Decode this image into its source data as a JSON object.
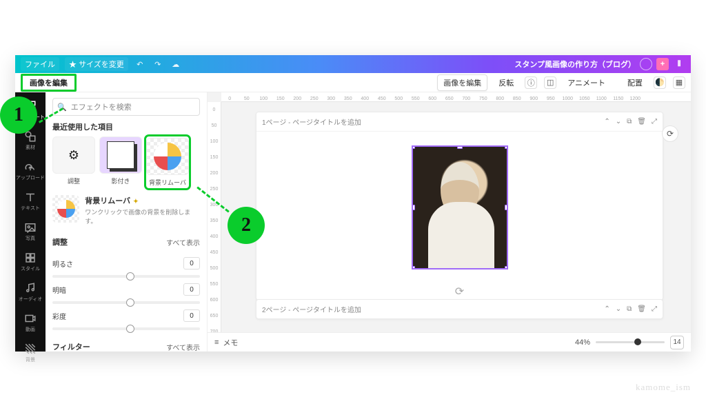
{
  "topbar": {
    "file": "ファイル",
    "resize": "サイズを変更",
    "title": "スタンプ風画像の作り方（ブログ）"
  },
  "ctxbar": {
    "edit_image": "画像を編集",
    "edit_image_btn": "画像を編集",
    "flip": "反転",
    "animate": "アニメート",
    "arrange": "配置"
  },
  "vnav": {
    "template": "テンプレート",
    "elements": "素材",
    "upload": "アップロード",
    "text": "テキスト",
    "photo": "写真",
    "style": "スタイル",
    "audio": "オーディオ",
    "video": "動画",
    "bg": "背景"
  },
  "panel": {
    "search_placeholder": "エフェクトを検索",
    "recent_title": "最近使用した項目",
    "thumbs": {
      "adjust": "調整",
      "shadow": "影付き",
      "bgremove": "背景リムーバ"
    },
    "promo": {
      "title": "背景リムーバ",
      "desc": "ワンクリックで画像の背景を削除します。"
    },
    "adjust_title": "調整",
    "show_all": "すべて表示",
    "sliders": {
      "brightness": "明るさ",
      "contrast": "明暗",
      "saturation": "彩度"
    },
    "slider_val": "0",
    "filter_title": "フィルター"
  },
  "canvas": {
    "ruler_h": [
      "0",
      "50",
      "100",
      "150",
      "200",
      "250",
      "300",
      "350",
      "400",
      "450",
      "500",
      "550",
      "600",
      "650",
      "700",
      "750",
      "800",
      "850",
      "900",
      "950",
      "1000",
      "1050",
      "1100",
      "1150",
      "1200"
    ],
    "ruler_v": [
      "0",
      "50",
      "100",
      "150",
      "200",
      "250",
      "300",
      "350",
      "400",
      "450",
      "500",
      "550",
      "600",
      "650",
      "700"
    ],
    "page1_title": "1ページ - ページタイトルを追加",
    "page2_title": "2ページ - ページタイトルを追加"
  },
  "bottom": {
    "memo": "メモ",
    "zoom": "44%",
    "pagecount": "14"
  },
  "callouts": {
    "one": "1",
    "two": "2"
  },
  "watermark": "kamome_ism"
}
